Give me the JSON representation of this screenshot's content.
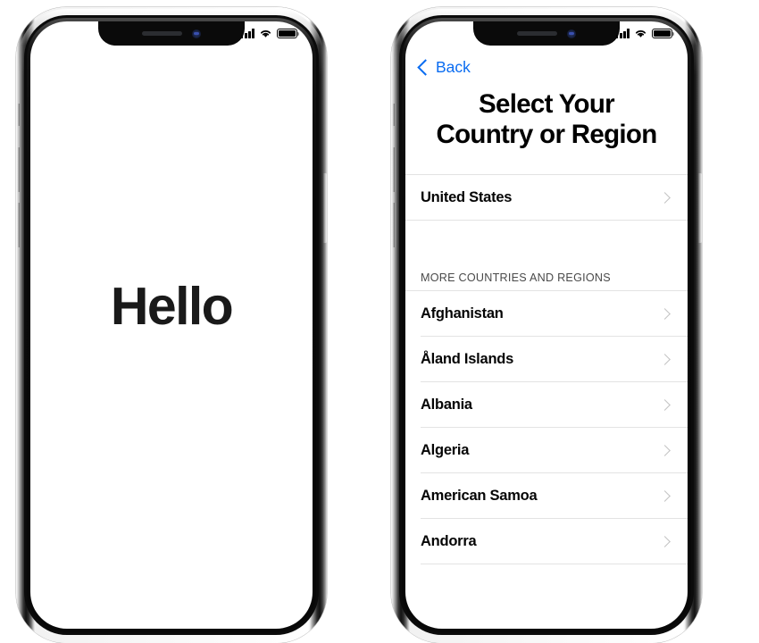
{
  "meta": {
    "scene": "Two iPhone X devices side by side showing iOS setup screens"
  },
  "statusbar": {
    "cellular_icon": "cellular-bars-icon",
    "cellular_bars": 4,
    "wifi_icon": "wifi-icon",
    "battery_icon": "battery-icon",
    "battery_level": 100
  },
  "notch": {
    "speaker_icon": "speaker-grille-icon",
    "camera_icon": "front-camera-icon"
  },
  "hardware": {
    "mute_switch": "mute-switch-button",
    "volume_up": "volume-up-button",
    "volume_down": "volume-down-button",
    "power": "power-button"
  },
  "phone_left": {
    "screen_name": "hello-screen",
    "greeting": "Hello"
  },
  "phone_right": {
    "screen_name": "select-country-screen",
    "back_label": "Back",
    "back_icon": "chevron-left-icon",
    "title": "Select Your Country or Region",
    "title_line1": "Select Your Country",
    "title_line2": "or Region",
    "current_region": {
      "label": "United States",
      "chevron": "chevron-right-icon"
    },
    "section_header": "MORE COUNTRIES AND REGIONS",
    "countries": [
      {
        "label": "Afghanistan"
      },
      {
        "label": "Åland Islands"
      },
      {
        "label": "Albania"
      },
      {
        "label": "Algeria"
      },
      {
        "label": "American Samoa"
      },
      {
        "label": "Andorra"
      }
    ]
  },
  "colors": {
    "ios_blue": "#0a6cf1",
    "separator": "#e3e3e3",
    "chevron_gray": "#c3c3c3",
    "section_header_gray": "#4a4a4a",
    "screen_bg": "#ffffff"
  }
}
